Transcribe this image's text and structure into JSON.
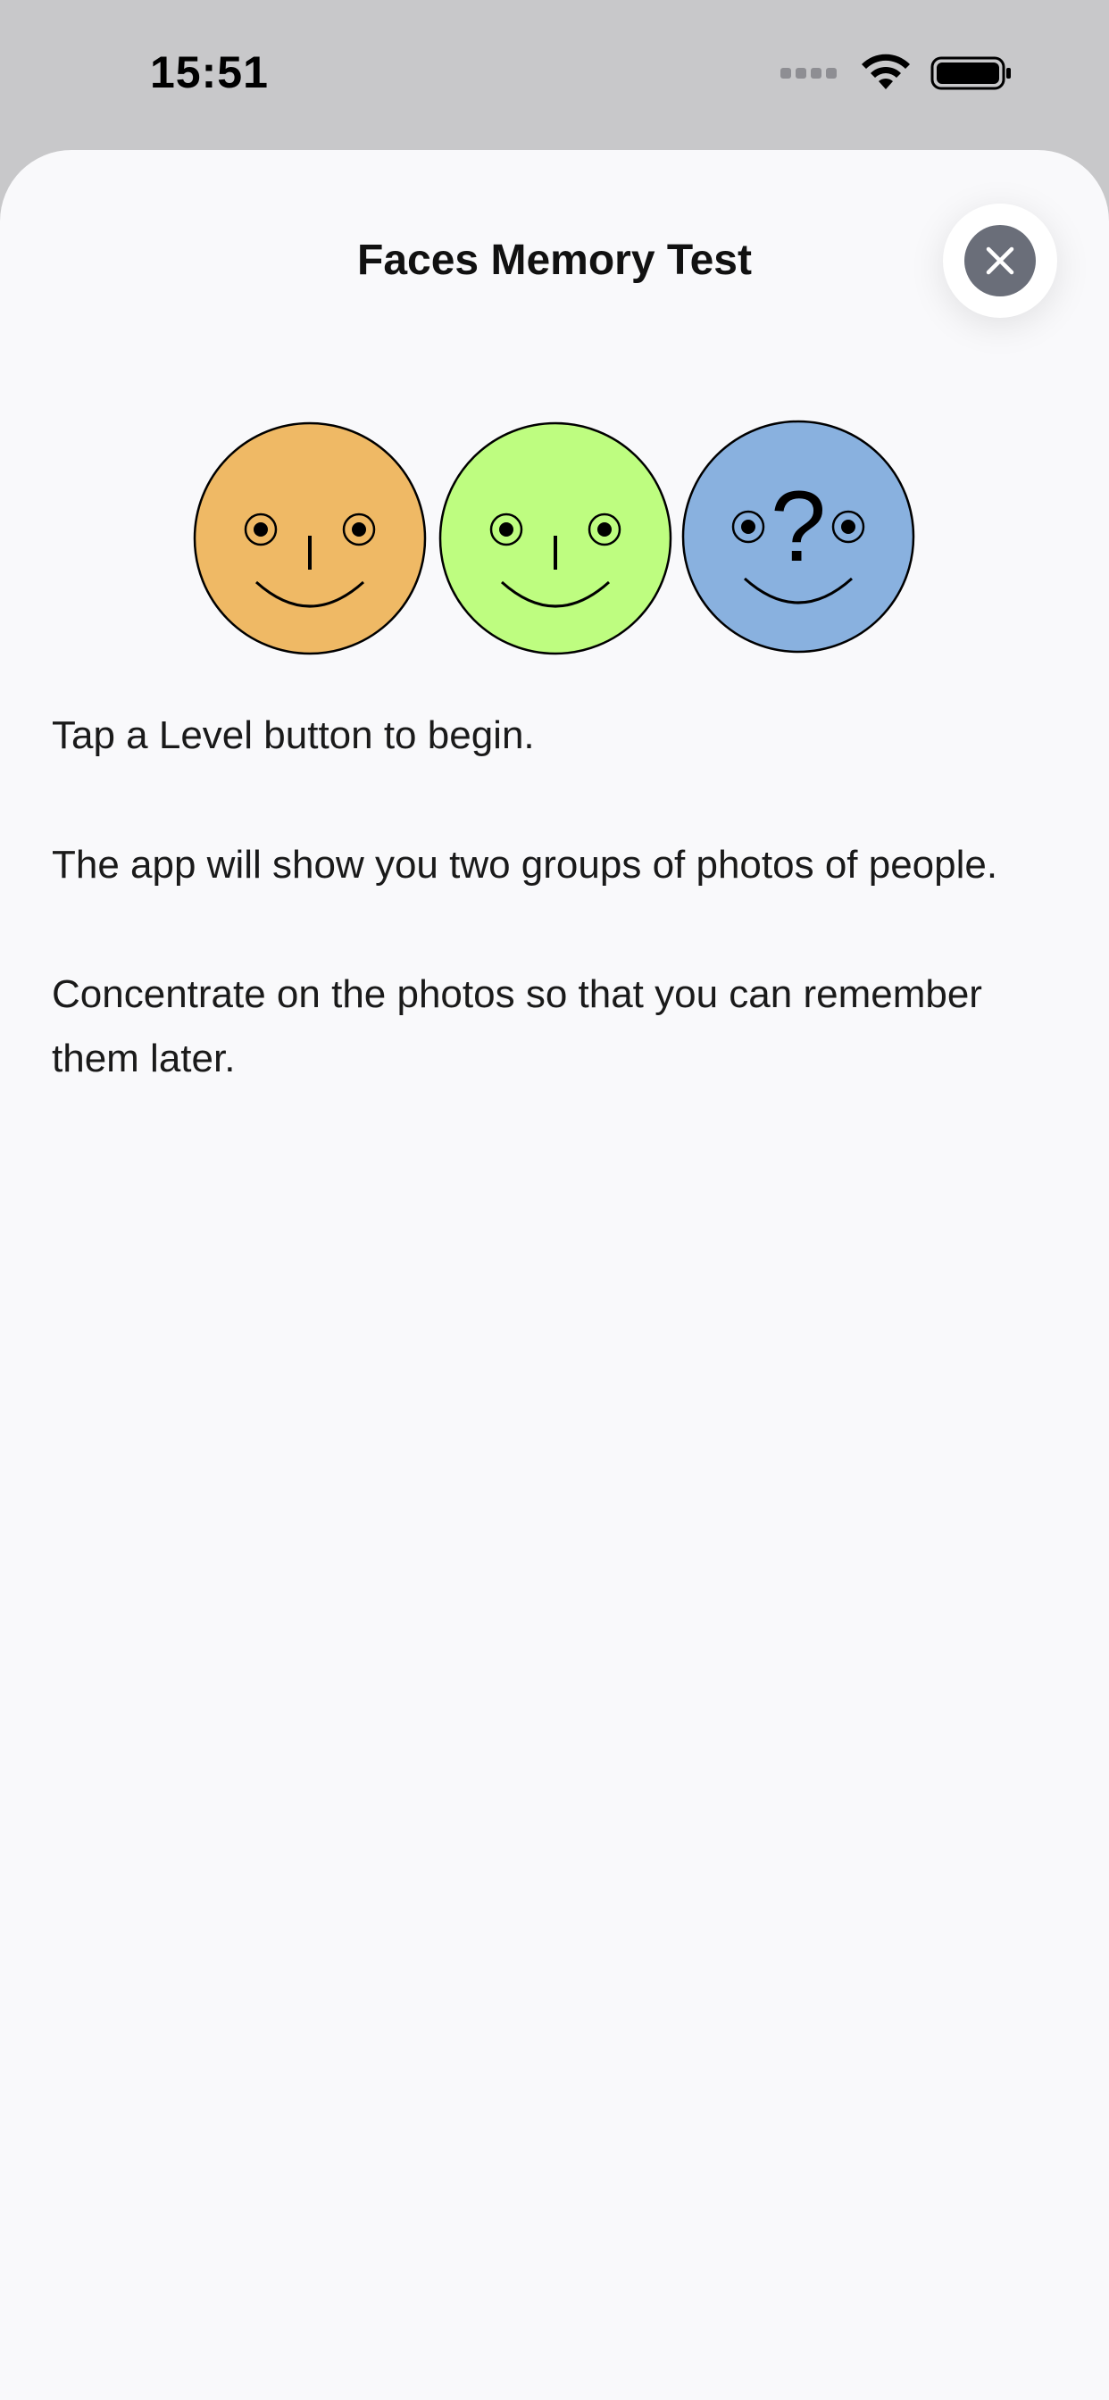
{
  "status_bar": {
    "time": "15:51",
    "icons": [
      "cellular-signal-icon",
      "wifi-icon",
      "battery-icon"
    ]
  },
  "sheet": {
    "title": "Faces Memory Test",
    "close_icon": "close-icon",
    "faces": [
      {
        "name": "orange-face",
        "color": "#efb965"
      },
      {
        "name": "green-face",
        "color": "#befd80"
      },
      {
        "name": "blue-face",
        "color": "#89b1df",
        "symbol": "?"
      }
    ],
    "paragraphs": [
      "Tap a Level button to begin.",
      "The app will show you two groups of photos of people.",
      "Concentrate on the photos so that you can remember them later."
    ]
  }
}
